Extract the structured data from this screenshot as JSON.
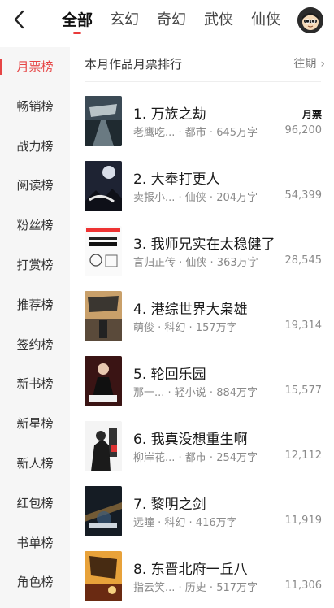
{
  "header": {
    "tabs": [
      {
        "label": "全部",
        "active": true
      },
      {
        "label": "玄幻"
      },
      {
        "label": "奇幻"
      },
      {
        "label": "武侠"
      },
      {
        "label": "仙侠"
      }
    ]
  },
  "sidebar": {
    "items": [
      {
        "label": "月票榜",
        "active": true
      },
      {
        "label": "畅销榜"
      },
      {
        "label": "战力榜"
      },
      {
        "label": "阅读榜"
      },
      {
        "label": "粉丝榜"
      },
      {
        "label": "打赏榜"
      },
      {
        "label": "推荐榜"
      },
      {
        "label": "签约榜"
      },
      {
        "label": "新书榜"
      },
      {
        "label": "新星榜"
      },
      {
        "label": "新人榜"
      },
      {
        "label": "红包榜"
      },
      {
        "label": "书单榜"
      },
      {
        "label": "角色榜"
      }
    ]
  },
  "main": {
    "section_title": "本月作品月票排行",
    "history_label": "往期",
    "count_label": "月票",
    "books": [
      {
        "title": "1. 万族之劫",
        "meta": "老鹰吃... · 都市 · 645万字",
        "count": "96,200"
      },
      {
        "title": "2. 大奉打更人",
        "meta": "卖报小... · 仙侠 · 204万字",
        "count": "54,399"
      },
      {
        "title": "3. 我师兄实在太稳健了",
        "meta": "言归正传 · 仙侠 · 363万字",
        "count": "28,545"
      },
      {
        "title": "4. 港综世界大枭雄",
        "meta": "萌俊 · 科幻 · 157万字",
        "count": "19,314"
      },
      {
        "title": "5. 轮回乐园",
        "meta": "那一... · 轻小说 · 884万字",
        "count": "15,577"
      },
      {
        "title": "6. 我真没想重生啊",
        "meta": "柳岸花... · 都市 · 254万字",
        "count": "12,112"
      },
      {
        "title": "7. 黎明之剑",
        "meta": "远瞳 · 科幻 · 416万字",
        "count": "11,919"
      },
      {
        "title": "8. 东晋北府一丘八",
        "meta": "指云笑... · 历史 · 517万字",
        "count": "11,306"
      }
    ]
  },
  "colors": {
    "accent": "#e64545",
    "sidebar_bg": "#f6f6f6"
  }
}
